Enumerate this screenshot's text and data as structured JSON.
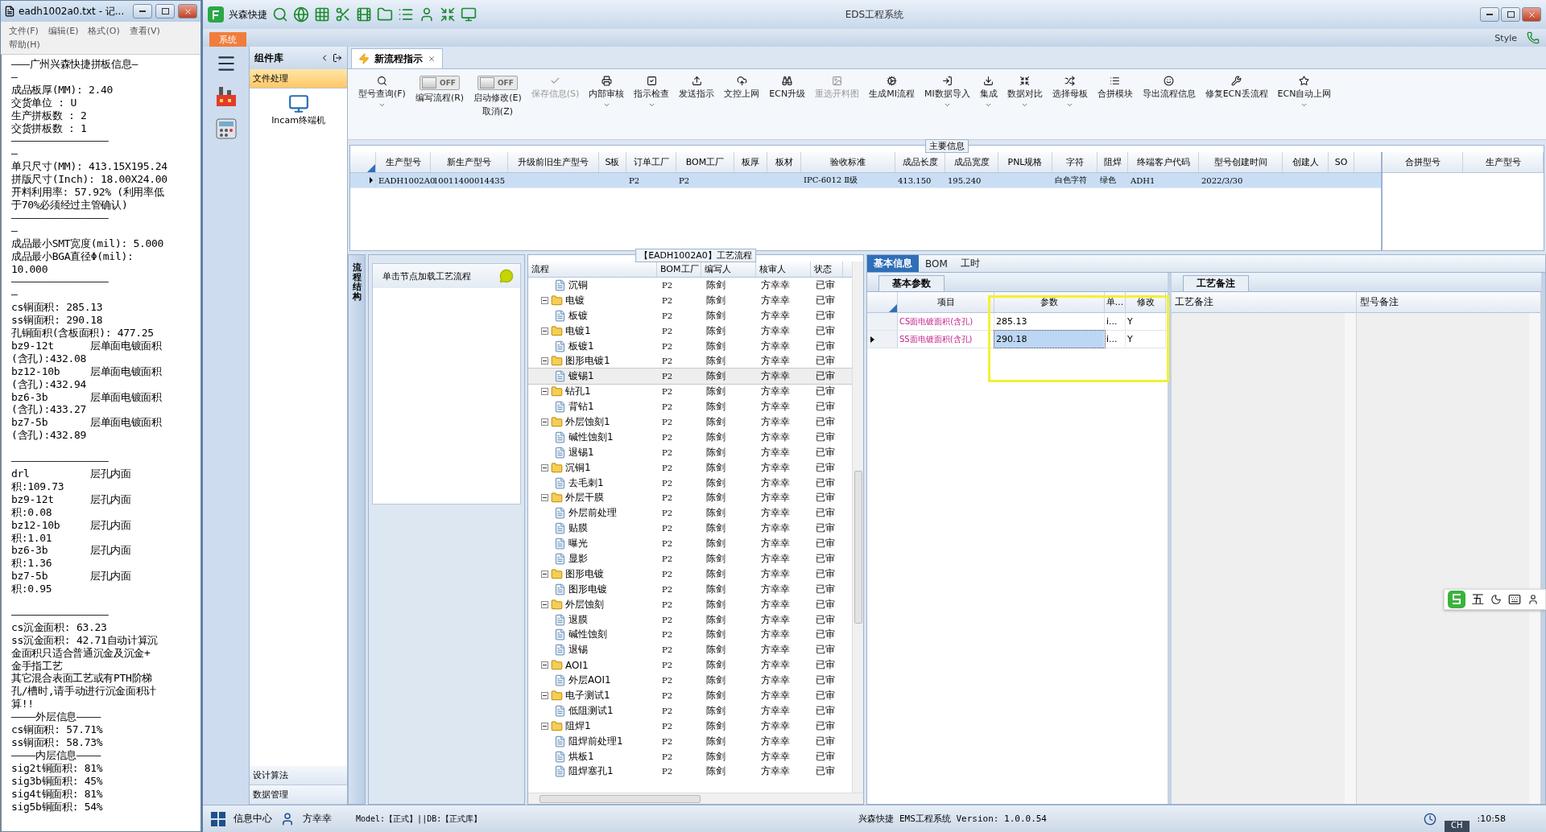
{
  "notepad": {
    "title": "eadh1002a0.txt - 记...",
    "menu": [
      "文件(F)",
      "编辑(E)",
      "格式(O)",
      "查看(V)",
      "帮助(H)"
    ],
    "blocks": [
      [
        "———广州兴森快捷拼板信息—",
        "—",
        "成品板厚(MM): 2.40",
        "交货单位 : U",
        "生产拼板数 : 2",
        "交货拼板数 : 1",
        "————————————————",
        "—",
        "单只尺寸(MM): 413.15X195.24",
        "拼版尺寸(Inch): 18.00X24.00",
        "开料利用率: 57.92% (利用率低",
        "于70%必须经过主管确认)",
        "————————————————",
        "—",
        "成品最小SMT宽度(mil): 5.000",
        "成品最小BGA直径Φ(mil):",
        "10.000",
        "————————————————",
        "—",
        "cs铜面积: 285.13",
        "ss铜面积: 290.18",
        "孔铜面积(含板面积): 477.25",
        "bz9-12t      层单面电镀面积",
        "(含孔):432.08",
        "bz12-10b     层单面电镀面积",
        "(含孔):432.94",
        "bz6-3b       层单面电镀面积",
        "(含孔):433.27",
        "bz7-5b       层单面电镀面积",
        "(含孔):432.89"
      ],
      [
        "————————————————",
        "drl          层孔内面",
        "积:109.73",
        "bz9-12t      层孔内面",
        "积:0.08",
        "bz12-10b     层孔内面",
        "积:1.01",
        "bz6-3b       层孔内面",
        "积:1.36",
        "bz7-5b       层孔内面",
        "积:0.95"
      ],
      [
        "————————————————",
        "cs沉金面积: 63.23",
        "ss沉金面积: 42.71自动计算沉",
        "金面积只适合普通沉金及沉金+",
        "金手指工艺",
        "其它混合表面工艺或有PTH阶梯",
        "孔/槽时,请手动进行沉金面积计",
        "算!!",
        "————外层信息————",
        "cs铜面积: 57.71%",
        "ss铜面积: 58.73%",
        "————内层信息————",
        "sig2t铜面积: 81%",
        "sig3b铜面积: 45%",
        "sig4t铜面积: 81%",
        "sig5b铜面积: 54%"
      ]
    ]
  },
  "window": {
    "brand": "兴森快捷",
    "title": "EDS工程系统"
  },
  "ribbon": {
    "tabs": [
      {
        "label": "系统",
        "selected": true
      }
    ],
    "style_label": "Style"
  },
  "component_library": {
    "title": "组件库",
    "items": [
      {
        "label": "文件处理",
        "selected": true
      }
    ],
    "tools": [
      {
        "label": "Incam终端机"
      }
    ],
    "bottom_items": [
      {
        "label": "设计算法",
        "selected": false
      },
      {
        "label": "数据管理",
        "selected": false
      }
    ]
  },
  "document_tabs": [
    {
      "label": "新流程指示",
      "selected": true
    }
  ],
  "toolbar": [
    {
      "kind": "button",
      "lines": [
        "型号查询(F)"
      ],
      "dropdown": true,
      "disabled": false
    },
    {
      "kind": "toggle",
      "text": "OFF",
      "on": false,
      "lines": [
        "编写流程(R)"
      ]
    },
    {
      "kind": "toggle",
      "text": "OFF",
      "on": false,
      "lines": [
        "启动修改(E)",
        "取消(Z)"
      ]
    },
    {
      "kind": "button",
      "lines": [
        "保存信息(S)"
      ],
      "dropdown": false,
      "disabled": true
    },
    {
      "kind": "button",
      "lines": [
        "内部审核"
      ],
      "dropdown": true,
      "disabled": false
    },
    {
      "kind": "button",
      "lines": [
        "指示检查"
      ],
      "dropdown": true,
      "disabled": false
    },
    {
      "kind": "button",
      "lines": [
        "发送指示"
      ],
      "dropdown": false,
      "disabled": false
    },
    {
      "kind": "button",
      "lines": [
        "文控上网"
      ],
      "dropdown": false,
      "disabled": false
    },
    {
      "kind": "button",
      "lines": [
        "ECN升级"
      ],
      "dropdown": false,
      "disabled": false
    },
    {
      "kind": "button",
      "lines": [
        "重选开料图"
      ],
      "dropdown": false,
      "disabled": true
    },
    {
      "kind": "button",
      "lines": [
        "生成MI流程"
      ],
      "dropdown": false,
      "disabled": false
    },
    {
      "kind": "button",
      "lines": [
        "MI数据导入"
      ],
      "dropdown": true,
      "disabled": false
    },
    {
      "kind": "button",
      "lines": [
        "集成"
      ],
      "dropdown": true,
      "disabled": false
    },
    {
      "kind": "button",
      "lines": [
        "数据对比"
      ],
      "dropdown": true,
      "disabled": false
    },
    {
      "kind": "button",
      "lines": [
        "选择母板"
      ],
      "dropdown": true,
      "disabled": false
    },
    {
      "kind": "button",
      "lines": [
        "合拼模块"
      ],
      "dropdown": false,
      "disabled": false
    },
    {
      "kind": "button",
      "lines": [
        "导出流程信息"
      ],
      "dropdown": false,
      "disabled": false
    },
    {
      "kind": "button",
      "lines": [
        "修复ECN丢流程"
      ],
      "dropdown": false,
      "disabled": false
    },
    {
      "kind": "button",
      "lines": [
        "ECN自动上网"
      ],
      "dropdown": true,
      "disabled": false
    }
  ],
  "main_info": {
    "title": "主要信息",
    "columns": [
      "生产型号",
      "新生产型号",
      "升级前旧生产型号",
      "S板",
      "订单工厂",
      "BOM工厂",
      "板厚",
      "板材",
      "验收标准",
      "成品长度",
      "成品宽度",
      "PNL规格",
      "字符",
      "阻焊",
      "终端客户代码",
      "型号创建时间",
      "创建人",
      "SO"
    ],
    "rows": [
      {
        "selected": true,
        "cells": [
          "EADH1002A0",
          "10011400014435",
          null,
          null,
          "P2",
          "P2",
          null,
          null,
          "IPC-6012 Ⅱ级",
          "413.150",
          "195.240",
          null,
          "白色字符",
          "绿色",
          "ADH1",
          "2022/3/30",
          null,
          null
        ]
      }
    ],
    "side_columns": [
      "合拼型号",
      "生产型号"
    ]
  },
  "flow_panel": {
    "side_tab": "流程结构",
    "hint": "单击节点加载工艺流程"
  },
  "flow_tree": {
    "title": "【EADH1002A0】工艺流程",
    "columns": [
      "流程",
      "BOM工厂",
      "编写人",
      "核审人",
      "状态"
    ],
    "nodes": [
      {
        "kind": "file",
        "name": "沉铜",
        "bom": "P2",
        "writer": "陈剑",
        "reviewer": "方幸幸",
        "status": "已审",
        "selected": false
      },
      {
        "kind": "folder",
        "name": "电镀",
        "bom": "P2",
        "writer": "陈剑",
        "reviewer": "方幸幸",
        "status": "已审",
        "expanded": true,
        "children": [
          {
            "kind": "file",
            "name": "板镀",
            "bom": "P2",
            "writer": "陈剑",
            "reviewer": "方幸幸",
            "status": "已审",
            "selected": false
          }
        ]
      },
      {
        "kind": "folder",
        "name": "电镀1",
        "bom": "P2",
        "writer": "陈剑",
        "reviewer": "方幸幸",
        "status": "已审",
        "expanded": true,
        "children": [
          {
            "kind": "file",
            "name": "板镀1",
            "bom": "P2",
            "writer": "陈剑",
            "reviewer": "方幸幸",
            "status": "已审",
            "selected": false
          }
        ]
      },
      {
        "kind": "folder",
        "name": "图形电镀1",
        "bom": "P2",
        "writer": "陈剑",
        "reviewer": "方幸幸",
        "status": "已审",
        "expanded": true,
        "children": [
          {
            "kind": "file",
            "name": "镀锡1",
            "bom": "P2",
            "writer": "陈剑",
            "reviewer": "方幸幸",
            "status": "已审",
            "selected": true
          }
        ]
      },
      {
        "kind": "folder",
        "name": "钻孔1",
        "bom": "P2",
        "writer": "陈剑",
        "reviewer": "方幸幸",
        "status": "已审",
        "expanded": true,
        "children": [
          {
            "kind": "file",
            "name": "背钻1",
            "bom": "P2",
            "writer": "陈剑",
            "reviewer": "方幸幸",
            "status": "已审",
            "selected": false
          }
        ]
      },
      {
        "kind": "folder",
        "name": "外层蚀刻1",
        "bom": "P2",
        "writer": "陈剑",
        "reviewer": "方幸幸",
        "status": "已审",
        "expanded": true,
        "children": [
          {
            "kind": "file",
            "name": "碱性蚀刻1",
            "bom": "P2",
            "writer": "陈剑",
            "reviewer": "方幸幸",
            "status": "已审",
            "selected": false
          },
          {
            "kind": "file",
            "name": "退锡1",
            "bom": "P2",
            "writer": "陈剑",
            "reviewer": "方幸幸",
            "status": "已审",
            "selected": false
          }
        ]
      },
      {
        "kind": "folder",
        "name": "沉铜1",
        "bom": "P2",
        "writer": "陈剑",
        "reviewer": "方幸幸",
        "status": "已审",
        "expanded": true,
        "children": [
          {
            "kind": "file",
            "name": "去毛刺1",
            "bom": "P2",
            "writer": "陈剑",
            "reviewer": "方幸幸",
            "status": "已审",
            "selected": false
          }
        ]
      },
      {
        "kind": "folder",
        "name": "外层干膜",
        "bom": "P2",
        "writer": "陈剑",
        "reviewer": "方幸幸",
        "status": "已审",
        "expanded": true,
        "children": [
          {
            "kind": "file",
            "name": "外层前处理",
            "bom": "P2",
            "writer": "陈剑",
            "reviewer": "方幸幸",
            "status": "已审",
            "selected": false
          },
          {
            "kind": "file",
            "name": "贴膜",
            "bom": "P2",
            "writer": "陈剑",
            "reviewer": "方幸幸",
            "status": "已审",
            "selected": false
          },
          {
            "kind": "file",
            "name": "曝光",
            "bom": "P2",
            "writer": "陈剑",
            "reviewer": "方幸幸",
            "status": "已审",
            "selected": false
          },
          {
            "kind": "file",
            "name": "显影",
            "bom": "P2",
            "writer": "陈剑",
            "reviewer": "方幸幸",
            "status": "已审",
            "selected": false
          }
        ]
      },
      {
        "kind": "folder",
        "name": "图形电镀",
        "bom": "P2",
        "writer": "陈剑",
        "reviewer": "方幸幸",
        "status": "已审",
        "expanded": true,
        "children": [
          {
            "kind": "file",
            "name": "图形电镀",
            "bom": "P2",
            "writer": "陈剑",
            "reviewer": "方幸幸",
            "status": "已审",
            "selected": false
          }
        ]
      },
      {
        "kind": "folder",
        "name": "外层蚀刻",
        "bom": "P2",
        "writer": "陈剑",
        "reviewer": "方幸幸",
        "status": "已审",
        "expanded": true,
        "children": [
          {
            "kind": "file",
            "name": "退膜",
            "bom": "P2",
            "writer": "陈剑",
            "reviewer": "方幸幸",
            "status": "已审",
            "selected": false
          },
          {
            "kind": "file",
            "name": "碱性蚀刻",
            "bom": "P2",
            "writer": "陈剑",
            "reviewer": "方幸幸",
            "status": "已审",
            "selected": false
          },
          {
            "kind": "file",
            "name": "退锡",
            "bom": "P2",
            "writer": "陈剑",
            "reviewer": "方幸幸",
            "status": "已审",
            "selected": false
          }
        ]
      },
      {
        "kind": "folder",
        "name": "AOI1",
        "bom": "P2",
        "writer": "陈剑",
        "reviewer": "方幸幸",
        "status": "已审",
        "expanded": true,
        "children": [
          {
            "kind": "file",
            "name": "外层AOI1",
            "bom": "P2",
            "writer": "陈剑",
            "reviewer": "方幸幸",
            "status": "已审",
            "selected": false
          }
        ]
      },
      {
        "kind": "folder",
        "name": "电子测试1",
        "bom": "P2",
        "writer": "陈剑",
        "reviewer": "方幸幸",
        "status": "已审",
        "expanded": true,
        "children": [
          {
            "kind": "file",
            "name": "低阻测试1",
            "bom": "P2",
            "writer": "陈剑",
            "reviewer": "方幸幸",
            "status": "已审",
            "selected": false
          }
        ]
      },
      {
        "kind": "folder",
        "name": "阻焊1",
        "bom": "P2",
        "writer": "陈剑",
        "reviewer": "方幸幸",
        "status": "已审",
        "expanded": true,
        "children": [
          {
            "kind": "file",
            "name": "阻焊前处理1",
            "bom": "P2",
            "writer": "陈剑",
            "reviewer": "方幸幸",
            "status": "已审",
            "selected": false
          },
          {
            "kind": "file",
            "name": "烘板1",
            "bom": "P2",
            "writer": "陈剑",
            "reviewer": "方幸幸",
            "status": "已审",
            "selected": false
          },
          {
            "kind": "file",
            "name": "阻焊塞孔1",
            "bom": "P2",
            "writer": "陈剑",
            "reviewer": "方幸幸",
            "status": "已审",
            "selected": false
          }
        ]
      }
    ]
  },
  "detail_tabs": [
    {
      "label": "基本信息",
      "selected": true
    },
    {
      "label": "BOM",
      "selected": false
    },
    {
      "label": "工时",
      "selected": false
    }
  ],
  "basic_params": {
    "tab": "基本参数",
    "columns": [
      "项目",
      "参数",
      "单...",
      "修改"
    ],
    "rows": [
      {
        "item": "CS面电镀面积(含孔)",
        "value": "285.13",
        "unit": "i...",
        "modified": "Y",
        "selected": false
      },
      {
        "item": "SS面电镀面积(含孔)",
        "value": "290.18",
        "unit": "i...",
        "modified": "Y",
        "selected": true
      }
    ]
  },
  "process_notes": {
    "tab": "工艺备注",
    "columns": [
      "工艺备注",
      "型号备注"
    ]
  },
  "ime_bar": {
    "mode": "五",
    "lang": "CH"
  },
  "status_bar": {
    "section": "信息中心",
    "user": "方幸幸",
    "model": "Model:【正式】||DB:【正式库】",
    "version": "兴森快捷 EMS工程系统 Version: 1.0.0.54",
    "time": ":10:58"
  }
}
